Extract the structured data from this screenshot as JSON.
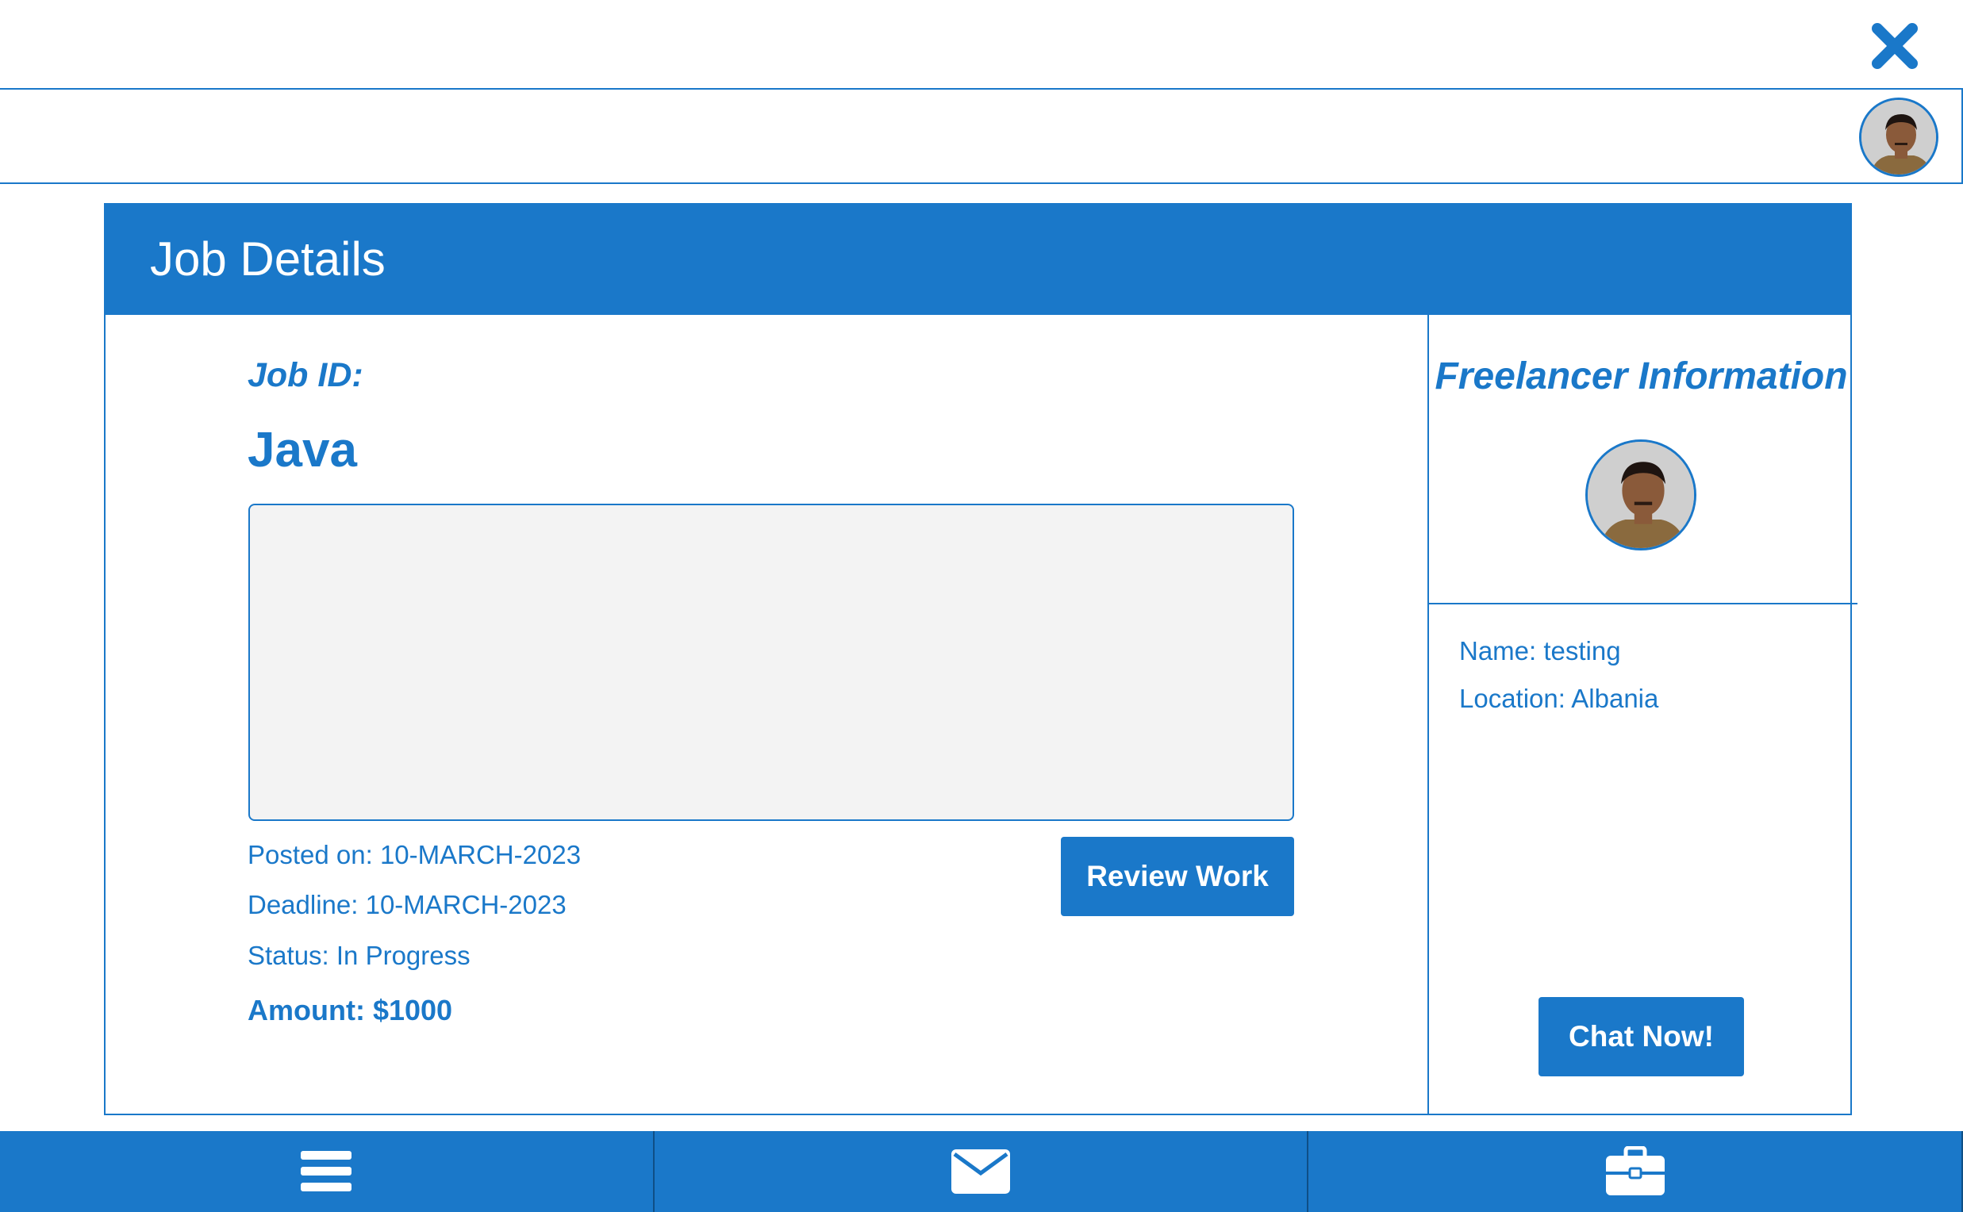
{
  "window": {
    "close_icon": "close-icon"
  },
  "header": {
    "avatar_icon": "user-avatar-icon"
  },
  "card": {
    "title": "Job Details",
    "job_id_label": "Job ID:",
    "job_title": "Java",
    "description": "",
    "posted_on": "Posted on: 10-MARCH-2023",
    "deadline": "Deadline: 10-MARCH-2023",
    "status": "Status: In Progress",
    "amount": "Amount: $1000",
    "review_button": "Review Work"
  },
  "freelancer": {
    "title": "Freelancer Information",
    "name": "Name: testing",
    "location": "Location: Albania",
    "chat_button": "Chat Now!"
  },
  "bottom_nav": {
    "items": [
      {
        "icon": "menu-icon"
      },
      {
        "icon": "envelope-icon"
      },
      {
        "icon": "briefcase-icon"
      }
    ]
  },
  "colors": {
    "accent": "#1a78c9",
    "description_bg": "#f3f3f3",
    "background": "#ffffff"
  }
}
